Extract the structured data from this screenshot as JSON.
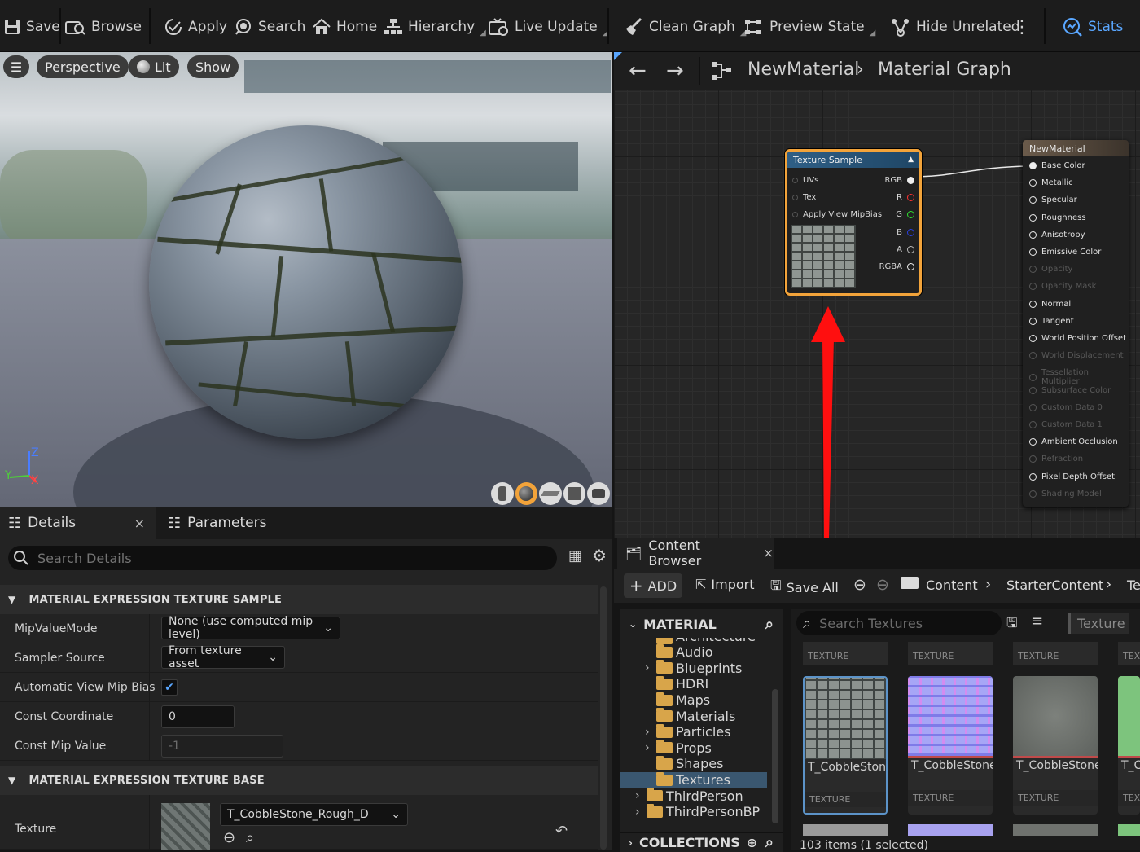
{
  "toolbar": {
    "items": [
      {
        "label": "Save",
        "icon": "save-icon"
      },
      {
        "label": "Browse",
        "icon": "browse-icon"
      },
      {
        "label": "Apply",
        "icon": "apply-icon"
      },
      {
        "label": "Search",
        "icon": "search-icon"
      },
      {
        "label": "Home",
        "icon": "home-icon"
      },
      {
        "label": "Hierarchy",
        "icon": "hierarchy-icon"
      },
      {
        "label": "Live Update",
        "icon": "live-update-icon"
      },
      {
        "label": "Clean Graph",
        "icon": "broom-icon"
      },
      {
        "label": "Preview State",
        "icon": "preview-state-icon"
      },
      {
        "label": "Hide Unrelated",
        "icon": "hide-unrelated-icon"
      },
      {
        "label": "Stats",
        "icon": "stats-icon"
      }
    ]
  },
  "viewport": {
    "perspective": "Perspective",
    "lit": "Lit",
    "show": "Show",
    "axis_z": "Z",
    "axis_x": "X",
    "axis_y": "Y"
  },
  "details": {
    "tab_details": "Details",
    "tab_parameters": "Parameters",
    "search_placeholder": "Search Details",
    "section1": "MATERIAL EXPRESSION TEXTURE SAMPLE",
    "section2": "MATERIAL EXPRESSION TEXTURE BASE",
    "rows": [
      {
        "label": "MipValueMode",
        "value": "None (use computed mip level)"
      },
      {
        "label": "Sampler Source",
        "value": "From texture asset"
      },
      {
        "label": "Automatic View Mip Bias",
        "value": "checked"
      },
      {
        "label": "Const Coordinate",
        "value": "0"
      },
      {
        "label": "Const Mip Value",
        "value": "-1"
      }
    ],
    "texture_label": "Texture",
    "texture_value": "T_CobbleStone_Rough_D"
  },
  "graph": {
    "breadcrumb_root": "NewMaterial",
    "breadcrumb_leaf": "Material Graph",
    "texture_node": {
      "title": "Texture Sample",
      "inputs": [
        "UVs",
        "Tex",
        "Apply View MipBias"
      ],
      "outputs": [
        "RGB",
        "R",
        "G",
        "B",
        "A",
        "RGBA"
      ]
    },
    "material_node": {
      "title": "NewMaterial",
      "pins": [
        {
          "label": "Base Color",
          "enabled": true
        },
        {
          "label": "Metallic",
          "enabled": true
        },
        {
          "label": "Specular",
          "enabled": true
        },
        {
          "label": "Roughness",
          "enabled": true
        },
        {
          "label": "Anisotropy",
          "enabled": true
        },
        {
          "label": "Emissive Color",
          "enabled": true
        },
        {
          "label": "Opacity",
          "enabled": false
        },
        {
          "label": "Opacity Mask",
          "enabled": false
        },
        {
          "label": "Normal",
          "enabled": true
        },
        {
          "label": "Tangent",
          "enabled": true
        },
        {
          "label": "World Position Offset",
          "enabled": true
        },
        {
          "label": "World Displacement",
          "enabled": false
        },
        {
          "label": "Tessellation Multiplier",
          "enabled": false
        },
        {
          "label": "Subsurface Color",
          "enabled": false
        },
        {
          "label": "Custom Data 0",
          "enabled": false
        },
        {
          "label": "Custom Data 1",
          "enabled": false
        },
        {
          "label": "Ambient Occlusion",
          "enabled": true
        },
        {
          "label": "Refraction",
          "enabled": false
        },
        {
          "label": "Pixel Depth Offset",
          "enabled": true
        },
        {
          "label": "Shading Model",
          "enabled": false
        }
      ]
    }
  },
  "content_browser": {
    "tab": "Content Browser",
    "add": "ADD",
    "import": "Import",
    "save_all": "Save All",
    "path": [
      "Content",
      "StarterContent",
      "Te"
    ],
    "tree_header": "MATERIAL",
    "folders": [
      "Architecture",
      "Audio",
      "Blueprints",
      "HDRI",
      "Maps",
      "Materials",
      "Particles",
      "Props",
      "Shapes",
      "Textures",
      "ThirdPerson",
      "ThirdPersonBP"
    ],
    "collections": "COLLECTIONS",
    "search_placeholder": "Search Textures",
    "filter_chip": "Texture",
    "type_label": "TEXTURE",
    "assets": [
      {
        "name": "T_CobbleStone_Rough_",
        "type": "TEXTURE",
        "selected": true
      },
      {
        "name": "T_CobbleStone_Rough_",
        "type": "TEXTURE",
        "selected": false
      },
      {
        "name": "T_CobbleStone_Smooth",
        "type": "TEXTURE",
        "selected": false
      },
      {
        "name": "T_CSto",
        "type": "TEX",
        "selected": false
      }
    ],
    "status": "103 items (1 selected)"
  },
  "colors": {
    "accent": "#f2a33a",
    "selection": "#5c93c8",
    "arrow": "#ff0f0f"
  }
}
